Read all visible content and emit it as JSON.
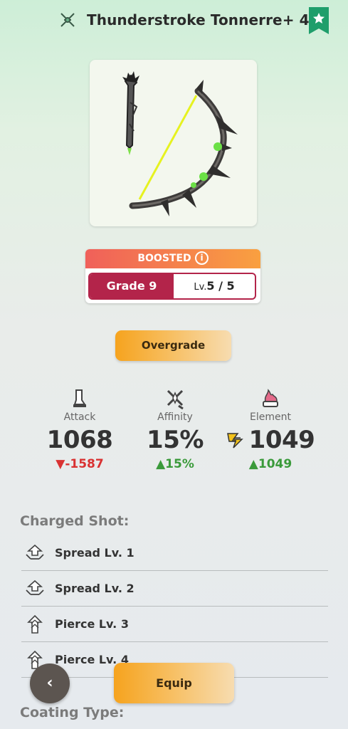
{
  "header": {
    "title": "Thunderstroke Tonnerre+ 4",
    "weapon_type_icon": "bow-icon",
    "favorite_icon": "star-bookmark-icon",
    "favorite_color": "#1f9e6b"
  },
  "weapon_image": {
    "icon": "bow-weapon-image"
  },
  "grade": {
    "boosted_label": "BOOSTED",
    "info_icon": "info-icon",
    "grade_label": "Grade 9",
    "level_prefix": "Lv.",
    "level_value": "5 / 5",
    "accent_color": "#b3244a"
  },
  "overgrade": {
    "label": "Overgrade"
  },
  "stats": {
    "attack": {
      "label": "Attack",
      "value": "1068",
      "change": "▼-1587",
      "icon": "attack-sword-icon"
    },
    "affinity": {
      "label": "Affinity",
      "value": "15%",
      "change": "▲15%",
      "icon": "affinity-icon"
    },
    "element": {
      "label": "Element",
      "value": "1049",
      "change": "▲1049",
      "icon": "element-fire-icon",
      "type_icon": "thunder-element-icon"
    }
  },
  "charged_shot": {
    "title": "Charged Shot:",
    "items": [
      {
        "label": "Spread Lv. 1",
        "icon": "spread-shot-icon"
      },
      {
        "label": "Spread Lv. 2",
        "icon": "spread-shot-icon"
      },
      {
        "label": "Pierce Lv. 3",
        "icon": "pierce-shot-icon"
      },
      {
        "label": "Pierce Lv. 4",
        "icon": "pierce-shot-icon"
      }
    ]
  },
  "coating": {
    "title": "Coating Type:"
  },
  "actions": {
    "back_label": "‹",
    "equip_label": "Equip"
  }
}
